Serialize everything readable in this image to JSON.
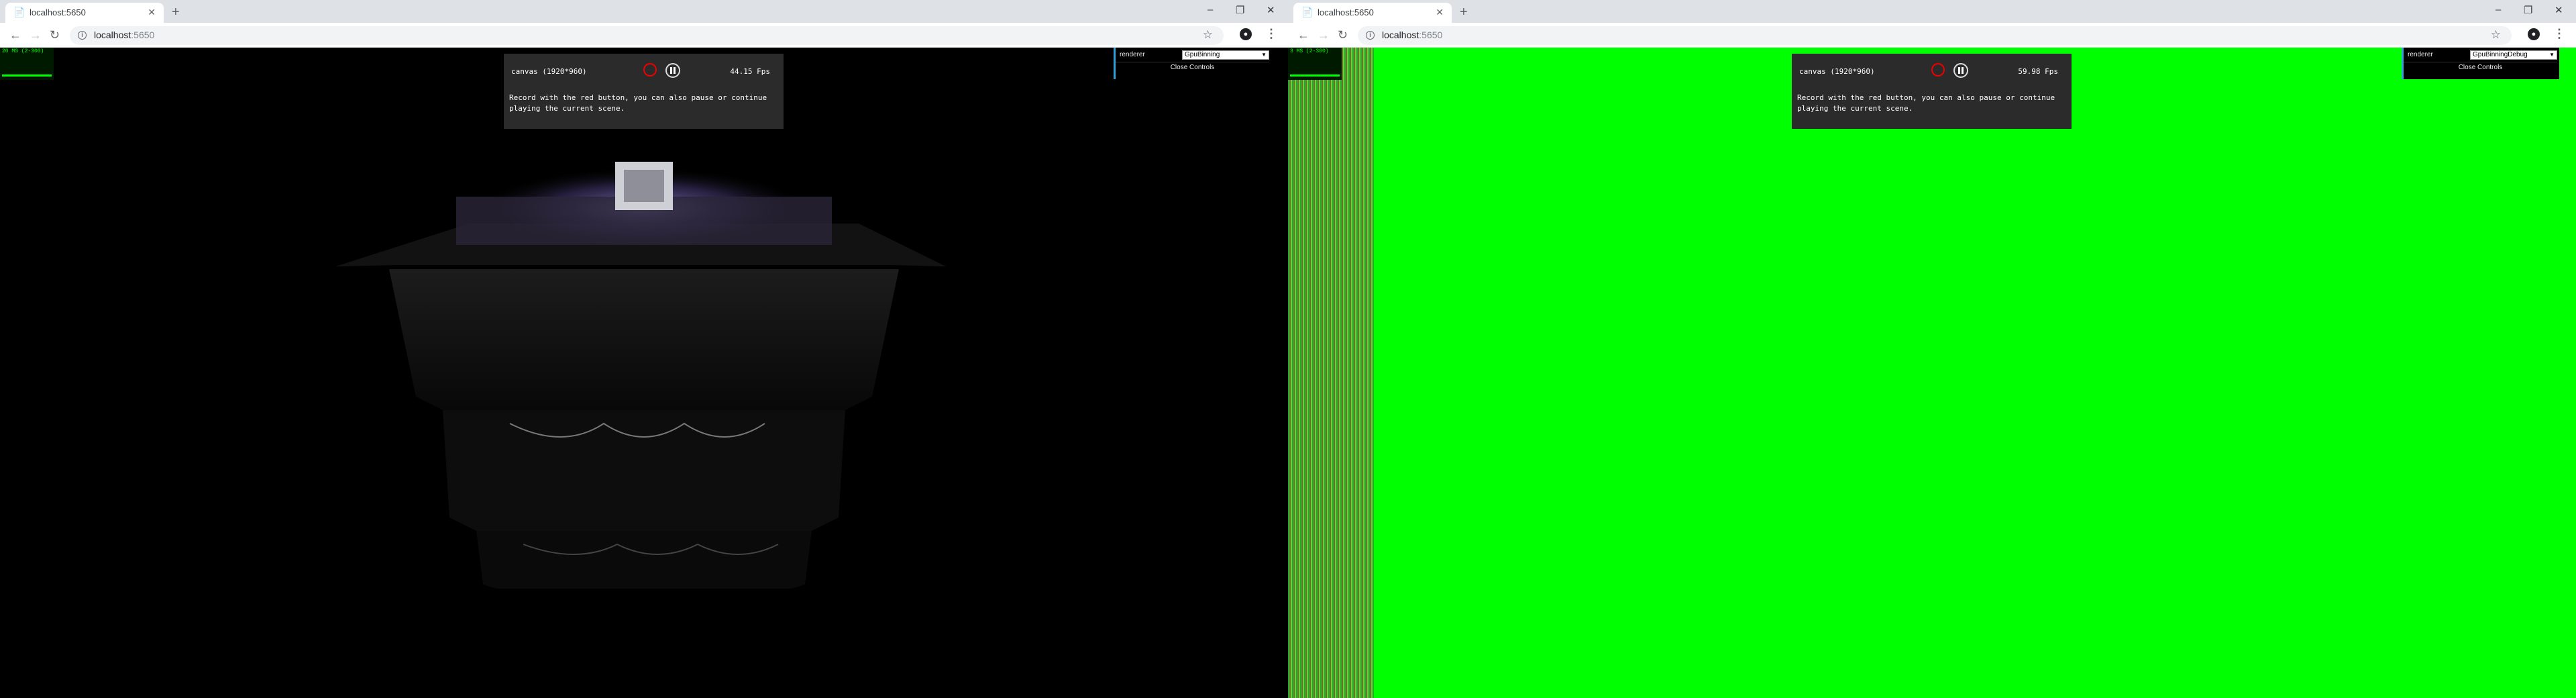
{
  "windows": [
    {
      "tab": {
        "title": "localhost:5650"
      },
      "url": {
        "host": "localhost",
        "port": ":5650"
      },
      "stats": {
        "text": "20 MS (2-300)"
      },
      "panel": {
        "canvas_label": "canvas (1920*960)",
        "fps": "44.15 Fps",
        "hint": "Record with the red button, you can also pause or continue playing the current scene."
      },
      "controls": {
        "label": "renderer",
        "selected": "GpuBinning",
        "close": "Close Controls"
      }
    },
    {
      "tab": {
        "title": "localhost:5650"
      },
      "url": {
        "host": "localhost",
        "port": ":5650"
      },
      "stats": {
        "text": "3 MS (2-300)"
      },
      "panel": {
        "canvas_label": "canvas (1920*960)",
        "fps": "59.98 Fps",
        "hint": "Record with the red button, you can also pause or continue playing the current scene."
      },
      "controls": {
        "label": "renderer",
        "selected": "GpuBinningDebug",
        "close": "Close Controls"
      }
    }
  ],
  "icons": {
    "favicon": "page-icon",
    "tab_close": "close-icon",
    "new_tab": "plus-icon",
    "back": "back-arrow-icon",
    "forward": "forward-arrow-icon",
    "reload": "reload-icon",
    "info": "info-icon",
    "star": "star-icon",
    "profile": "profile-icon",
    "menu": "menu-icon",
    "minimize": "minimize-icon",
    "restore": "restore-icon",
    "close_window": "close-window-icon"
  },
  "colors": {
    "debug_green": "#00ff00",
    "record_red": "#ee0000",
    "panel_bg": "#2b2b2b",
    "controls_accent": "#2fa1d6"
  }
}
